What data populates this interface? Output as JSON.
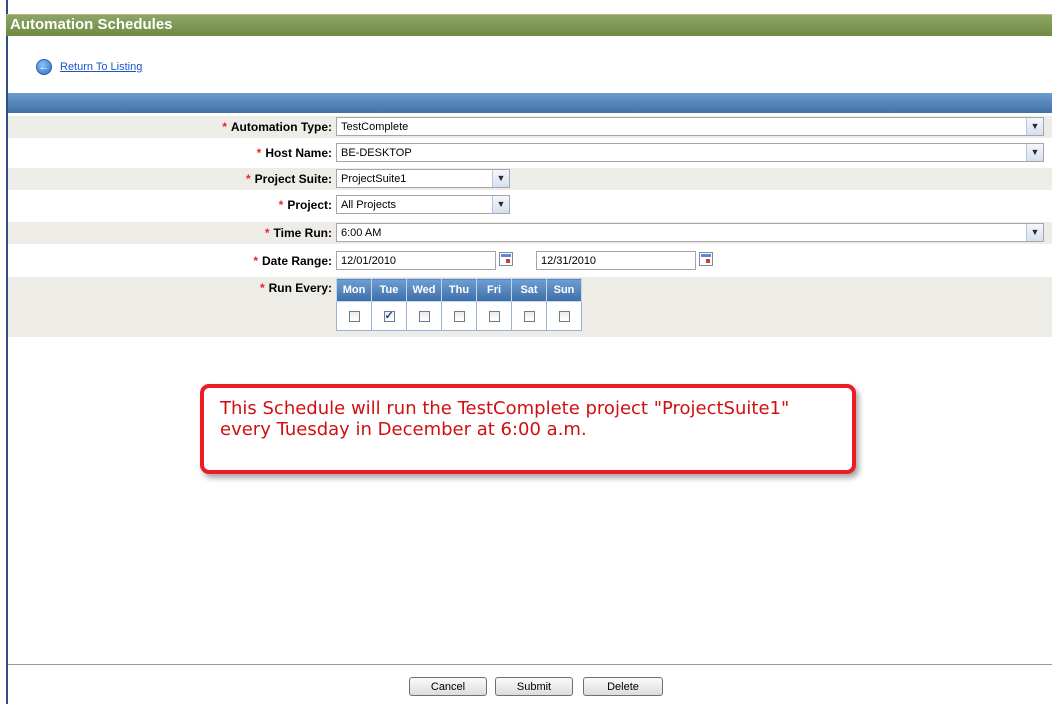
{
  "title": "Automation Schedules",
  "return_link": {
    "label": "Return To Listing",
    "icon": "back-arrow-icon"
  },
  "required_marker": "*",
  "fields": {
    "automation_type": {
      "label": "Automation Type:",
      "value": "TestComplete"
    },
    "host_name": {
      "label": "Host Name:",
      "value": "BE-DESKTOP"
    },
    "project_suite": {
      "label": "Project Suite:",
      "value": "ProjectSuite1"
    },
    "project": {
      "label": "Project:",
      "value": "All Projects"
    },
    "time_run": {
      "label": "Time Run:",
      "value": "6:00 AM"
    },
    "date_range": {
      "label": "Date Range:",
      "start": "12/01/2010",
      "end": "12/31/2010"
    },
    "run_every": {
      "label": "Run Every:",
      "days": [
        {
          "label": "Mon",
          "checked": false
        },
        {
          "label": "Tue",
          "checked": true
        },
        {
          "label": "Wed",
          "checked": false
        },
        {
          "label": "Thu",
          "checked": false
        },
        {
          "label": "Fri",
          "checked": false
        },
        {
          "label": "Sat",
          "checked": false
        },
        {
          "label": "Sun",
          "checked": false
        }
      ]
    }
  },
  "callout": {
    "line1": "This Schedule will run the TestComplete project \"ProjectSuite1\"",
    "line2": "every Tuesday in December at 6:00 a.m."
  },
  "buttons": {
    "cancel": "Cancel",
    "submit": "Submit",
    "delete": "Delete"
  },
  "colors": {
    "title_bar": "#7a9450",
    "header_bar": "#4f80b8",
    "required": "#e8242b",
    "callout_border": "#ea1c24"
  }
}
